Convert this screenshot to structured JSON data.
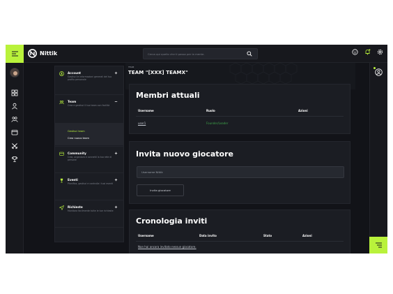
{
  "brand": {
    "name": "Nittik"
  },
  "search": {
    "placeholder": "Cerca qui quello che ti passa per la mente."
  },
  "colors": {
    "accent": "#b9f23b",
    "role_green": "#3ea34a",
    "background": "#121318"
  },
  "menu": {
    "items": [
      {
        "title": "Account",
        "desc": "Gestisci le informazioni generali del tuo profilo personale",
        "icon": "account-circle-icon"
      },
      {
        "title": "Team",
        "desc": "Crea e gestisci il tuo team con facilità",
        "icon": "team-icon"
      },
      {
        "title": "Community",
        "desc": "Crea, organizza e connetti la tua rete di persone",
        "icon": "community-icon"
      },
      {
        "title": "Eventi",
        "desc": "Pianifica, gestisci e controlla i tuoi eventi",
        "icon": "trophy-icon"
      },
      {
        "title": "Richieste",
        "desc": "Monitora facilmente tutte le tue richieste",
        "icon": "send-icon"
      }
    ],
    "team_sub": {
      "manage": "Gestisci team",
      "create": "Crea nuovo team"
    }
  },
  "header": {
    "crumb": "TEAM",
    "title": "TEAM \"[XXX] TEAMX\""
  },
  "members": {
    "title": "Membri attuali",
    "cols": [
      "Username",
      "Ruolo",
      "Azioni"
    ],
    "rows": [
      {
        "username": "user1",
        "role": "Founder/Leader"
      }
    ]
  },
  "invite": {
    "title": "Invita nuovo giocatore",
    "placeholder": "Username Nittik",
    "button": "Invita giocatore"
  },
  "history": {
    "title": "Cronologia inviti",
    "cols": [
      "Username",
      "Data invito",
      "Stato",
      "Azioni"
    ],
    "empty": "Non hai ancora invitato nessun giocatore."
  }
}
